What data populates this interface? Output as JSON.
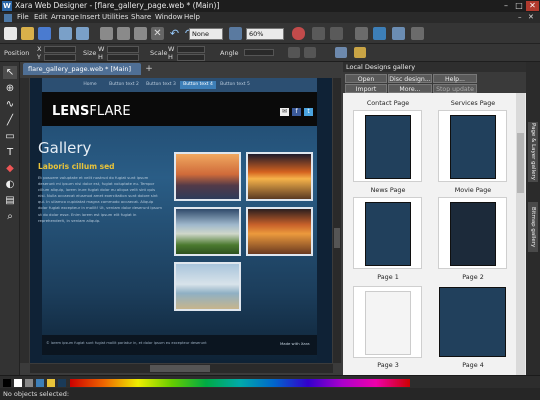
{
  "window": {
    "title": "Xara Web Designer - [flare_gallery_page.web * (Main)]",
    "logo": "W"
  },
  "window_controls": [
    "–",
    "□",
    "✕"
  ],
  "menu": [
    "File",
    "Edit",
    "Arrange",
    "Insert",
    "Utilities",
    "Share",
    "Window",
    "Help"
  ],
  "toolbar": {
    "quality": "None",
    "zoom": "60%"
  },
  "infobar": {
    "position": "Position",
    "x": "X",
    "y": "Y",
    "size": "Size",
    "w": "W",
    "h": "H",
    "scale": "Scale",
    "angle": "Angle"
  },
  "document_tab": "flare_gallery_page.web * [Main]",
  "document_tab_add": "+",
  "website": {
    "nav": [
      "Home",
      "Button text 2",
      "Button text 3",
      "Button text 4",
      "Button text 5"
    ],
    "logo_bold": "LENS",
    "logo_light": "FLARE",
    "social": [
      "✉",
      "f",
      "t"
    ],
    "heading": "Gallery",
    "subheading": "Laboris cillum sed",
    "body": "Et posuere voluptate et velit nostrud do fugiat sunt ipsum deserunt mi ipsum nisi dolor est, fugiat voluptate eu. Tempor cillum aliquip, lorem irure fugiat dolor eu aliqua velit sint quis nisi. Nulla occaecat eiusmod amet exercitation sunt dolore sint qui. In ullamco cupidatat magna commodo occaecat. Aliquip dolor fugiat excepteur in mollit! Ut, veniam dolor deserunt ipsum ut do dolor esse. Enim lorem est ipsum elit fugiat in reprehenderit, in veniam aliquip.",
    "footer_left": "© lorem ipsum fugiat sunt fugiat mollit pariatur in, et dolor ipsum eu excepteur deserunt",
    "footer_right": "Made with Xara"
  },
  "gallery": {
    "title": "Local Designs gallery",
    "buttons": [
      "Open",
      "Disc design...",
      "Help...",
      "Import",
      "More...",
      "Stop update"
    ],
    "items": [
      {
        "name": "Contact Page"
      },
      {
        "name": "Services Page"
      },
      {
        "name": "News Page"
      },
      {
        "name": "Movie Page"
      },
      {
        "name": "Page 1"
      },
      {
        "name": "Page 2"
      },
      {
        "name": "Page 3"
      },
      {
        "name": "Page 4"
      }
    ]
  },
  "side_tabs": [
    "Page & Layer gallery",
    "Bitmap gallery"
  ],
  "status": "No objects selected:",
  "colors": {
    "accent": "#3d7fb8",
    "heading": "#e8c33a",
    "canvas": "#1a3a58"
  },
  "icons": [
    "new-document-icon",
    "open-icon",
    "save-icon",
    "import-icon",
    "export-icon",
    "cut-icon",
    "copy-icon",
    "paste-icon",
    "delete-icon",
    "undo-icon",
    "redo-icon",
    "zoom-tool-icon",
    "selector-tool-icon",
    "freehand-tool-icon",
    "pen-tool-icon",
    "rectangle-tool-icon",
    "text-tool-icon",
    "fill-tool-icon",
    "transparency-tool-icon",
    "shadow-tool-icon",
    "photo-tool-icon"
  ]
}
